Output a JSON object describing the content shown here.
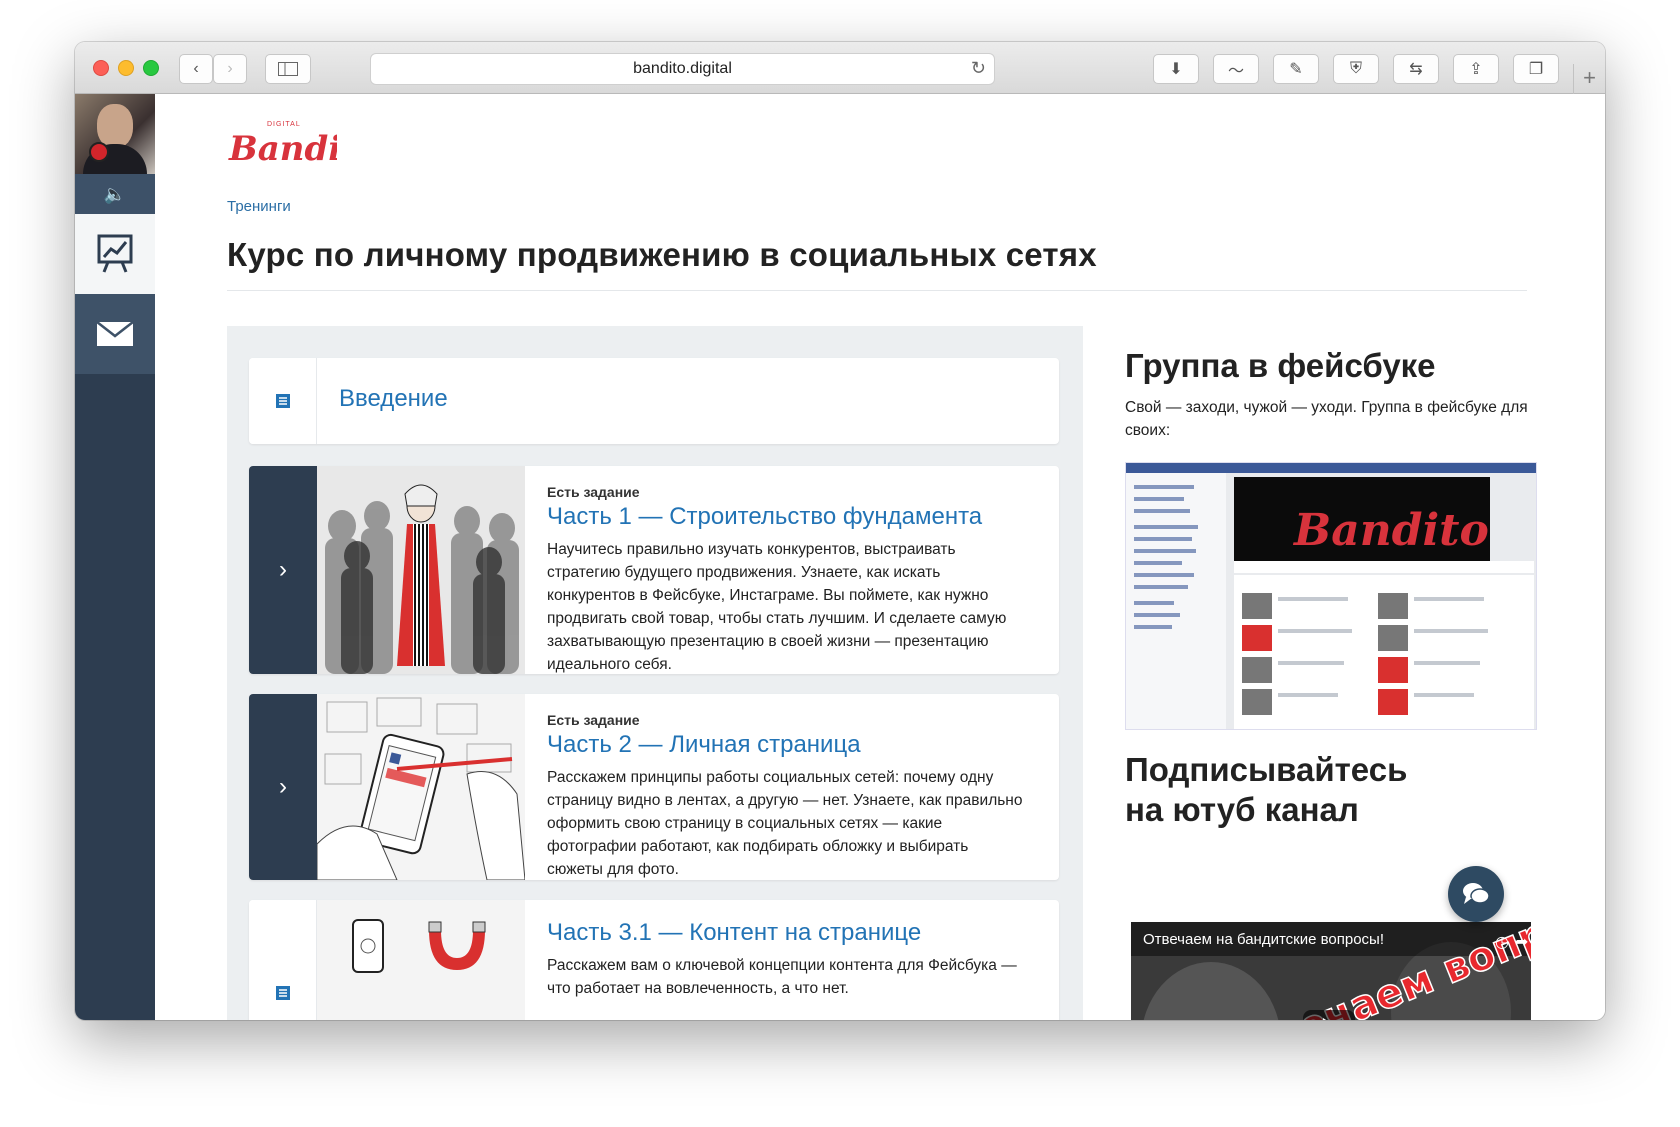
{
  "browser": {
    "url": "bandito.digital"
  },
  "site": {
    "logo_text": "Bandito",
    "logo_small": "DIGITAL"
  },
  "page": {
    "breadcrumb": "Тренинги",
    "title": "Курс по личному продвижению в социальных сетях"
  },
  "lessons": [
    {
      "title": "Введение"
    },
    {
      "tag": "Есть задание",
      "title": "Часть 1 — Строительство фундамента",
      "desc": "Научитесь правильно изучать конкурентов, выстраивать стратегию будущего продвижения. Узнаете, как искать конкурентов в Фейсбуке, Инстаграме. Вы поймете, как нужно продвигать свой товар, чтобы стать лучшим. И сделаете самую захватывающую презентацию в своей жизни — презентацию идеального себя."
    },
    {
      "tag": "Есть задание",
      "title": "Часть 2 — Личная страница",
      "desc": "Расскажем принципы работы социальных сетей: почему одну страницу видно в лентах, а другую — нет. Узнаете, как правильно оформить свою страницу в социальных сетях — какие фотографии работают, как подбирать обложку и выбирать сюжеты для фото."
    },
    {
      "title": "Часть 3.1 — Контент на странице",
      "desc": "Расскажем вам о ключевой концепции контента для Фейсбука — что работает на вовлеченность, а что нет."
    }
  ],
  "right": {
    "fb_heading": "Группа в фейсбуке",
    "fb_text": "Свой — заходи, чужой — уходи. Группа в фейсбуке для своих:",
    "yt_heading_1": "Подписывайтесь",
    "yt_heading_2": "на ютуб канал",
    "yt_video_title": "Отвечаем на бандитские вопросы!",
    "yt_overlay": "Отвечаем вопросы!"
  },
  "colors": {
    "accent": "#2273b5",
    "sidebar": "#2d3d50",
    "logo_red": "#d8333c"
  }
}
